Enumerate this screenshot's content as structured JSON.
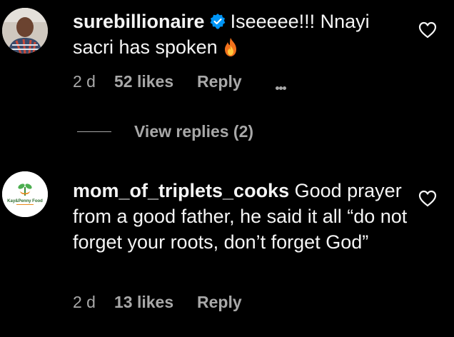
{
  "comments": [
    {
      "username": "surebillionaire",
      "verified": true,
      "text": "Iseeeee!!! Nnayi sacri has spoken",
      "emoji": "fire-icon",
      "time": "2 d",
      "likes": "52 likes",
      "reply_label": "Reply",
      "avatar": "person-photo"
    },
    {
      "username": "mom_of_triplets_cooks",
      "verified": false,
      "text": "Good prayer from a good father, he said it all “do not forget your roots, don’t forget God”",
      "time": "2 d",
      "likes": "13 likes",
      "reply_label": "Reply",
      "avatar": "logo",
      "avatar_text": "Kay&Penny Food"
    }
  ],
  "view_replies": "View replies (2)",
  "colors": {
    "background": "#000000",
    "text": "#f5f5f5",
    "secondary": "#a8a8a8",
    "verified": "#0095f6"
  }
}
